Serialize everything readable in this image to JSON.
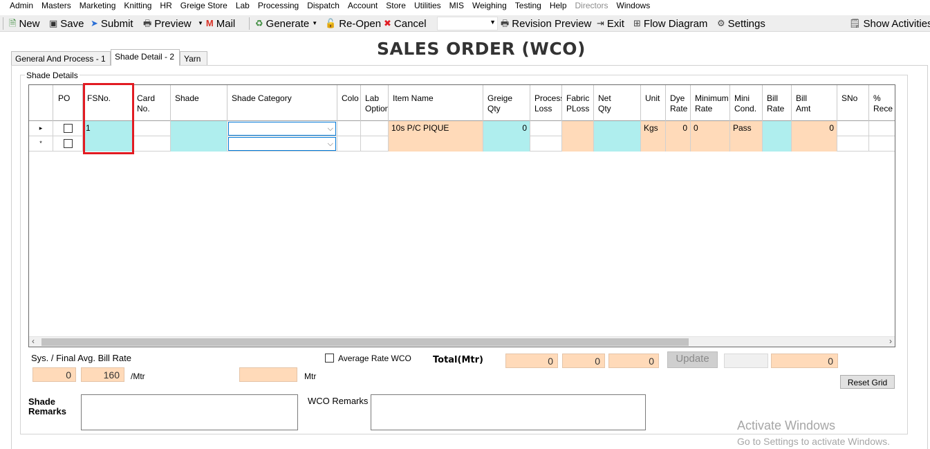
{
  "menu": [
    "Admin",
    "Masters",
    "Marketing",
    "Knitting",
    "HR",
    "Greige Store",
    "Lab",
    "Processing",
    "Dispatch",
    "Account",
    "Store",
    "Utilities",
    "MIS",
    "Weighing",
    "Testing",
    "Help",
    "Directors",
    "Windows"
  ],
  "toolbar": {
    "new": "New",
    "save": "Save",
    "submit": "Submit",
    "preview": "Preview",
    "mail": "Mail",
    "generate": "Generate",
    "reopen": "Re-Open",
    "cancel": "Cancel",
    "revision_preview": "Revision Preview",
    "exit": "Exit",
    "flow_diagram": "Flow Diagram",
    "settings": "Settings",
    "show_activities": "Show Activities"
  },
  "title": "SALES ORDER (WCO)",
  "tabs": [
    "General And Process - 1",
    "Shade Detail - 2",
    "Yarn"
  ],
  "active_tab": "Shade Detail - 2",
  "group_label": "Shade Details",
  "grid": {
    "columns": [
      "PO",
      "FSNo.",
      "Card No.",
      "Shade",
      "Shade Category",
      "Colo",
      "Lab Option",
      "Item Name",
      "Greige Qty",
      "Process Loss",
      "Fabric PLoss",
      "Net Qty",
      "Unit",
      "Dye Rate",
      "Minimum Rate",
      "Mini Cond.",
      "Bill Rate",
      "Bill Amt",
      "SNo",
      "% Rece"
    ],
    "rows": [
      {
        "indicator": "▸",
        "po": false,
        "fsno": "1",
        "card_no": "",
        "shade": "",
        "shade_category": "",
        "colo": "",
        "lab_option": "",
        "item_name": "10s P/C PIQUE",
        "greige_qty": "0",
        "process_loss": "",
        "fabric_ploss": "",
        "net_qty": "",
        "unit": "Kgs",
        "dye_rate": "0",
        "minimum_rate": "0",
        "mini_cond": "Pass",
        "bill_rate": "",
        "bill_amt": "0",
        "sno": "",
        "rece": ""
      },
      {
        "indicator": "*",
        "po": false,
        "fsno": "",
        "card_no": "",
        "shade": "",
        "shade_category": "",
        "colo": "",
        "lab_option": "",
        "item_name": "",
        "greige_qty": "",
        "process_loss": "",
        "fabric_ploss": "",
        "net_qty": "",
        "unit": "",
        "dye_rate": "",
        "minimum_rate": "",
        "mini_cond": "",
        "bill_rate": "",
        "bill_amt": "",
        "sno": "",
        "rece": ""
      }
    ]
  },
  "bottom": {
    "avg_rate_label": "Sys. / Final Avg. Bill Rate",
    "sys_rate": "0",
    "final_rate": "160",
    "per_unit": "/Mtr",
    "mtr_value": "",
    "mtr_label": "Mtr",
    "average_rate_wco_label": "Average Rate WCO",
    "average_rate_wco_checked": false,
    "total_label": "Total(Mtr)",
    "total_1": "0",
    "total_2": "0",
    "total_3": "0",
    "update_label": "Update",
    "blank_value": "",
    "total_4": "0",
    "reset_grid_label": "Reset Grid",
    "shade_remarks_label": "Shade Remarks",
    "shade_remarks_value": "",
    "wco_remarks_label": "WCO Remarks",
    "wco_remarks_value": ""
  },
  "watermark": {
    "line1": "Activate Windows",
    "line2": "Go to Settings to activate Windows."
  },
  "colors": {
    "cyan_cell": "#afeeee",
    "peach_cell": "#ffdab9",
    "highlight": "#e11b22"
  }
}
